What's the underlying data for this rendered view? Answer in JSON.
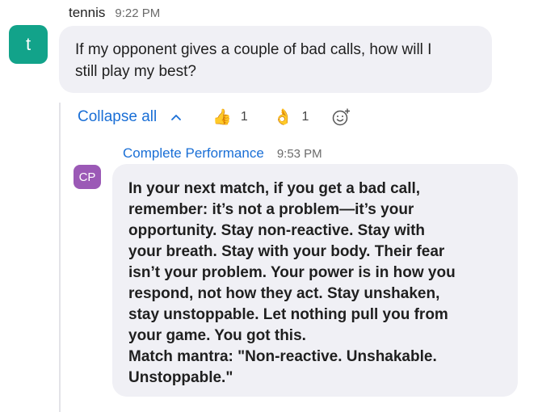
{
  "message": {
    "sender": "tennis",
    "time": "9:22 PM",
    "avatar_letter": "t",
    "text_lines": [
      "If my opponent gives a couple of bad calls, how will I",
      "still play my best?"
    ]
  },
  "thread": {
    "collapse_label": "Collapse all",
    "reactions": [
      {
        "emoji": "👍",
        "count": "1",
        "icon": "thumbs-up-icon"
      },
      {
        "emoji": "👌",
        "count": "1",
        "icon": "ok-hand-icon"
      }
    ],
    "add_reaction_icon": "add-reaction-icon"
  },
  "reply": {
    "sender": "Complete Performance",
    "time": "9:53 PM",
    "avatar_initials": "CP",
    "text_lines": [
      "In your next match, if you get a bad call,",
      "remember: it’s not a problem—it’s your",
      "opportunity. Stay non-reactive. Stay with",
      "your breath. Stay with your body. Their fear",
      "isn’t your problem. Your power is in how you",
      "respond, not how they act. Stay unshaken,",
      "stay unstoppable. Let nothing pull you from",
      "your game. You got this.",
      "Match mantra: \"Non-reactive. Unshakable.",
      "Unstoppable.\""
    ]
  },
  "colors": {
    "link_blue": "#1a6fd6",
    "avatar_t": "#12a38a",
    "avatar_cp": "#9b59b6",
    "bubble_bg": "#f0f0f5"
  }
}
